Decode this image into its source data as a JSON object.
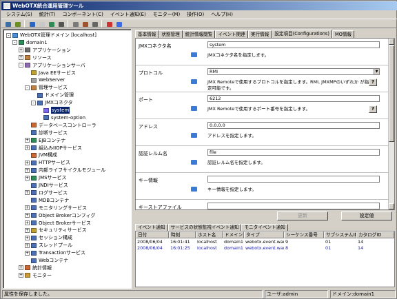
{
  "window": {
    "title": "WebOTX統合運用管理ツール"
  },
  "menu": [
    "システム(S)",
    "統計(T)",
    "コンポーネント(C)",
    "イベント通知(E)",
    "モニター(M)",
    "操作(O)",
    "ヘルプ(H)"
  ],
  "toolbar": {
    "icons": [
      {
        "name": "connect-icon",
        "color": "#3a6ea5"
      },
      {
        "name": "disconnect-icon",
        "color": "#6b8e23"
      },
      {
        "name": "up-icon",
        "color": "#2b66c4"
      },
      {
        "name": "new-icon",
        "color": "#c8c8c8"
      },
      {
        "name": "refresh-icon",
        "color": "#2e8b57"
      },
      {
        "name": "search-icon",
        "color": "#555"
      },
      {
        "name": "tool-icon",
        "color": "#7a7a7a"
      },
      {
        "name": "settings-icon",
        "color": "#a0522d"
      },
      {
        "name": "print-icon",
        "color": "#666"
      },
      {
        "name": "log-icon",
        "color": "#cc3333"
      },
      {
        "name": "window-icon",
        "color": "#4169e1"
      }
    ]
  },
  "tree": [
    {
      "label": "WebOTX管理ドメイン [localhost]",
      "level": 0,
      "exp": "-",
      "color": "#4a90d9"
    },
    {
      "label": "domain1",
      "level": 1,
      "exp": "-",
      "color": "#2e8b57"
    },
    {
      "label": "アプリケーション",
      "level": 2,
      "exp": "+",
      "color": "#6b6b6b"
    },
    {
      "label": "リソース",
      "level": 2,
      "exp": "+",
      "color": "#c08040"
    },
    {
      "label": "アプリケーションサーバ",
      "level": 2,
      "exp": "-",
      "color": "#8c6bb1"
    },
    {
      "label": "Java EEサービス",
      "level": 3,
      "exp": "",
      "color": "#c0a030"
    },
    {
      "label": "WebServer",
      "level": 3,
      "exp": "",
      "color": "#a0a0a0"
    },
    {
      "label": "管理サービス",
      "level": 3,
      "exp": "-",
      "color": "#c08040"
    },
    {
      "label": "ドメイン管理",
      "level": 4,
      "exp": "",
      "color": "#4a6fb5"
    },
    {
      "label": "JMXコネクタ",
      "level": 4,
      "exp": "-",
      "color": "#4a6fb5"
    },
    {
      "label": "system",
      "level": 5,
      "exp": "",
      "color": "#7b68ee",
      "selected": true
    },
    {
      "label": "system-option",
      "level": 5,
      "exp": "",
      "color": "#4a6fb5"
    },
    {
      "label": "データベースコントローラ",
      "level": 3,
      "exp": "",
      "color": "#cc6633"
    },
    {
      "label": "診断サービス",
      "level": 3,
      "exp": "",
      "color": "#4a6fb5"
    },
    {
      "label": "EJBコンテナ",
      "level": 3,
      "exp": "+",
      "color": "#2e8b57"
    },
    {
      "label": "組込みIIOPサービス",
      "level": 3,
      "exp": "+",
      "color": "#4a6fb5"
    },
    {
      "label": "JVM構成",
      "level": 3,
      "exp": "",
      "color": "#cc6633"
    },
    {
      "label": "HTTPサービス",
      "level": 3,
      "exp": "+",
      "color": "#4a6fb5"
    },
    {
      "label": "内部ライフサイクルモジュール",
      "level": 3,
      "exp": "+",
      "color": "#4a6fb5"
    },
    {
      "label": "JMSサービス",
      "level": 3,
      "exp": "+",
      "color": "#2e8b57"
    },
    {
      "label": "JNDIサービス",
      "level": 3,
      "exp": "",
      "color": "#4a6fb5"
    },
    {
      "label": "ログサービス",
      "level": 3,
      "exp": "+",
      "color": "#4a6fb5"
    },
    {
      "label": "MDBコンテナ",
      "level": 3,
      "exp": "",
      "color": "#4a6fb5"
    },
    {
      "label": "モニタリングサービス",
      "level": 3,
      "exp": "+",
      "color": "#4a6fb5"
    },
    {
      "label": "Object Brokerコンフィグ",
      "level": 3,
      "exp": "+",
      "color": "#4a6fb5"
    },
    {
      "label": "Object Brokerサービス",
      "level": 3,
      "exp": "+",
      "color": "#4a6fb5"
    },
    {
      "label": "セキュリティサービス",
      "level": 3,
      "exp": "+",
      "color": "#c0a030"
    },
    {
      "label": "セッション構成",
      "level": 3,
      "exp": "+",
      "color": "#4a6fb5"
    },
    {
      "label": "スレッドプール",
      "level": 3,
      "exp": "+",
      "color": "#4a6fb5"
    },
    {
      "label": "Transactionサービス",
      "level": 3,
      "exp": "+",
      "color": "#4a6fb5"
    },
    {
      "label": "Webコンテナ",
      "level": 3,
      "exp": "",
      "color": "#4a6fb5"
    },
    {
      "label": "統計情報",
      "level": 2,
      "exp": "+",
      "color": "#cc6633"
    },
    {
      "label": "モニター",
      "level": 2,
      "exp": "+",
      "color": "#cc9933"
    }
  ],
  "tabs": [
    "基本情報",
    "状態管理",
    "統計情報閲覧",
    "イベント関連",
    "実行情報",
    "設定項目(Configurations)",
    "MO情報"
  ],
  "active_tab": 5,
  "properties": [
    {
      "name": "JMXコネクタ名",
      "type": "text",
      "value": "system",
      "desc": "JMXコネクタ名を指定します。",
      "help": false
    },
    {
      "name": "プロトコル",
      "type": "select",
      "value": "RMI",
      "desc": "JMX Remoteで使用するプロトコルを指定します。RMI, JMXMPのいずれか が指定可能です。",
      "help": true
    },
    {
      "name": "ポート",
      "type": "text",
      "value": "6212",
      "desc": "JMX Remoteで使用するポート番号を指定します。",
      "help": true
    },
    {
      "name": "アドレス",
      "type": "text",
      "value": "0.0.0.0",
      "desc": "アドレスを指定します。",
      "help": false
    },
    {
      "name": "認証レルム名",
      "type": "text",
      "value": "file",
      "desc": "認証レルム名を指定します。",
      "help": false
    },
    {
      "name": "キー情報",
      "type": "text",
      "value": "",
      "desc": "キー情報を指定します。",
      "help": false
    },
    {
      "name": "キーストアファイル",
      "type": "text",
      "value": "",
      "desc": "キーストアファイルを指定します。",
      "help": false
    }
  ],
  "buttons": {
    "update": "更新",
    "apply": "設定値"
  },
  "event_tabs": [
    "イベント通知",
    "サービスの状態監視イベント通知",
    "モニタイベント通知"
  ],
  "event_columns": [
    "日付",
    "時刻",
    "ホスト名",
    "ドメイン名",
    "タイプ",
    "シーケンス番号",
    "サブシステムID",
    "カタログID"
  ],
  "events": [
    {
      "date": "2008/06/04",
      "time": "16:01:41",
      "host": "localhost",
      "domain": "domain1",
      "type": "webotx.event.warning",
      "seq": "9",
      "subsys": "01",
      "catalog": "14",
      "color": "#000000"
    },
    {
      "date": "2008/06/04",
      "time": "16:01:25",
      "host": "localhost",
      "domain": "domain1",
      "type": "webotx.event.warning",
      "seq": "8",
      "subsys": "01",
      "catalog": "14",
      "color": "#1a1aa6"
    }
  ],
  "status": {
    "message": "属性を保存しました。",
    "user": "ユーザ:admin",
    "domain": "ドメイン:domain1"
  }
}
